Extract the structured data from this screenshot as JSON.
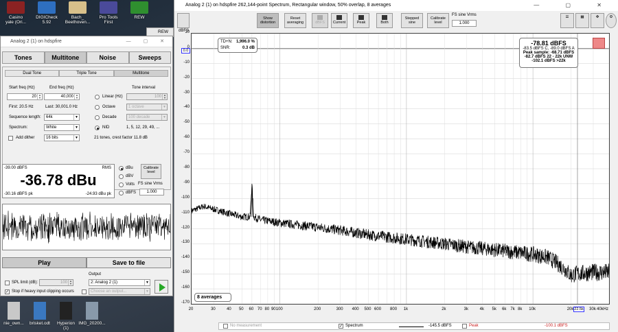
{
  "desktop": {
    "top_icons": [
      {
        "label": "Casino\nyale (Ori...",
        "color": "#8b2222"
      },
      {
        "label": "DIGICheck\n5.92",
        "color": "#2e6fc0"
      },
      {
        "label": "Bach_\nBeethoven...",
        "color": "#d8c08a"
      },
      {
        "label": "Pro Tools\nFirst",
        "color": "#4a4a9a"
      },
      {
        "label": "REW",
        "color": "#2f8f2f"
      }
    ],
    "bottom_icons": [
      {
        "label": "nie_own...",
        "color": "#c8c8c8"
      },
      {
        "label": "brisket.odt",
        "color": "#3a78c0"
      },
      {
        "label": "Hyperion\n(1)",
        "color": "#222"
      },
      {
        "label": "IMG_20200...",
        "color": "#8899aa"
      }
    ],
    "rew_tab": "REW"
  },
  "generator": {
    "title": "Analog 2 (1) on hdspfire",
    "tabs": [
      "Tones",
      "Multitone",
      "Noise",
      "Sweeps"
    ],
    "active_tab": 1,
    "subtabs": [
      "Dual Tone",
      "Triple Tone",
      "Multitone"
    ],
    "labels": {
      "start_freq": "Start freq (Hz)",
      "end_freq": "End freq (Hz)",
      "tone_interval": "Tone interval",
      "first": "First: 20.5 Hz",
      "last": "Last: 30,001.0 Hz",
      "seq_length": "Sequence length:",
      "spectrum": "Spectrum:",
      "add_dither": "Add dither",
      "linear": "Linear (Hz)",
      "octave": "Octave",
      "decade": "Decade",
      "nid": "NID",
      "nid_values": "1, 5, 12, 29, 49, ...",
      "tones_info": "21 tones, crest factor 11.8 dB"
    },
    "values": {
      "start_freq": "20",
      "end_freq": "40,000",
      "linear_value": "100",
      "octave_value": "1 octave",
      "decade_value": "100 decade",
      "seq_length": "64k",
      "spectrum": "White",
      "dither": "16 bits"
    },
    "meter": {
      "peak_label": "-39.00 dBFS",
      "mode": "RMS",
      "value": "-36.78 dBu",
      "pk_left": "-30.16 dBFS pk",
      "pk_right": "-24.93 dBu pk"
    },
    "units": [
      "dBu",
      "dBV",
      "Volts",
      "dBFS"
    ],
    "selected_unit": 0,
    "calibrate_label": "Calibrate level",
    "fs_sine_label": "FS sine Vrms",
    "fs_sine_value": "1.000",
    "play_label": "Play",
    "save_label": "Save to file",
    "spl_limit_label": "SPL limit (dB):",
    "spl_limit_value": "100",
    "stop_label": "Stop if heavy input clipping occurs",
    "output_label": "Output",
    "output_value": "2: Analog 2 (1)",
    "choose_output": "Choose an output..."
  },
  "analyzer": {
    "title": "Analog 2 (1) on hdspfire 262,144-point Spectrum, Rectangular window, 50% overlap, 8 averages",
    "toolbar": [
      {
        "label": "Show distortion",
        "state": "pressed"
      },
      {
        "label": "Reset averaging",
        "state": "normal"
      },
      {
        "label": "dBFS",
        "state": "disabled"
      },
      {
        "label": "Current",
        "state": "normal"
      },
      {
        "label": "Peak",
        "state": "normal"
      },
      {
        "label": "Both",
        "state": "normal"
      },
      {
        "label": "Stepped sine",
        "state": "normal"
      },
      {
        "label": "Calibrate level",
        "state": "normal"
      }
    ],
    "fs_sine_label": "FS sine Vrms",
    "fs_sine_value": "1.000",
    "y_unit": "dBFS",
    "y_marker": "0.0",
    "tdn": {
      "label": "TD+N:",
      "value": "1,996.0 %",
      "snr_label": "SNR:",
      "snr_value": "0.3 dB"
    },
    "level_box": {
      "main": "-78.81 dBFS",
      "lines": [
        "-83.5 dBFS C, -89.0 dBFS A",
        "Peak sample: -68.71 dBFS",
        "-82.7 dBFS 22 - 22k UNW",
        "-102.1 dBFS >22k"
      ]
    },
    "averages_label": "8 averages",
    "cursor_freq": "22.5k",
    "legend": {
      "no_measurement": "No measurement",
      "spectrum": "Spectrum",
      "spectrum_value": "-145.5 dBFS",
      "peak": "Peak",
      "peak_value": "-100.1 dBFS"
    }
  },
  "chart_data": {
    "type": "line",
    "y_ticks": [
      "10",
      "0",
      "-10",
      "-20",
      "-30",
      "-40",
      "-50",
      "-60",
      "-70",
      "-80",
      "-90",
      "-100",
      "-110",
      "-120",
      "-130",
      "-140",
      "-150",
      "-160",
      "-170"
    ],
    "ylim": [
      -170,
      10
    ],
    "x_ticks": [
      "20",
      "30",
      "40",
      "50",
      "60",
      "70",
      "80",
      "90",
      "100",
      "200",
      "300",
      "400",
      "500",
      "600",
      "800",
      "1k",
      "2k",
      "3k",
      "4k",
      "5k",
      "6k",
      "7k",
      "8k",
      "10k",
      "20k",
      "30k",
      "40kHz"
    ],
    "x_tick_values": [
      20,
      30,
      40,
      50,
      60,
      70,
      80,
      90,
      100,
      200,
      300,
      400,
      500,
      600,
      800,
      1000,
      2000,
      3000,
      4000,
      5000,
      6000,
      7000,
      8000,
      10000,
      20000,
      30000,
      40000
    ],
    "xlim": [
      20,
      40000
    ],
    "x_scale": "log",
    "series": [
      {
        "name": "Spectrum",
        "x": [
          20,
          25,
          30,
          40,
          50,
          58,
          60,
          62,
          70,
          100,
          200,
          300,
          500,
          1000,
          2000,
          3000,
          5000,
          8000,
          10000,
          13000,
          15000,
          18000,
          20000,
          22000,
          30000,
          40000
        ],
        "y": [
          -108,
          -105,
          -107,
          -110,
          -112,
          -112,
          -90,
          -112,
          -114,
          -116,
          -119,
          -121,
          -124,
          -127,
          -130,
          -132,
          -134,
          -136,
          -137,
          -139,
          -142,
          -147,
          -151,
          -150,
          -149,
          -149
        ]
      }
    ],
    "grid": true,
    "color": "#000000"
  }
}
